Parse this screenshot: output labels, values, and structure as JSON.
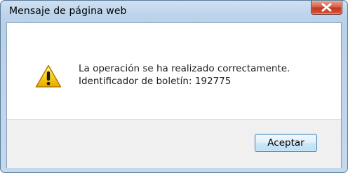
{
  "window": {
    "title": "Mensaje de página web",
    "close_icon": "close-x-icon"
  },
  "message": {
    "icon": "warning-triangle-icon",
    "line1": "La operación se ha realizado correctamente.",
    "line2": "Identificador de boletín: 192775"
  },
  "buttons": {
    "ok_label": "Aceptar"
  },
  "colors": {
    "close_button": "#c4371c",
    "warning": "#f5c400",
    "button_border": "#3c7fb1"
  }
}
